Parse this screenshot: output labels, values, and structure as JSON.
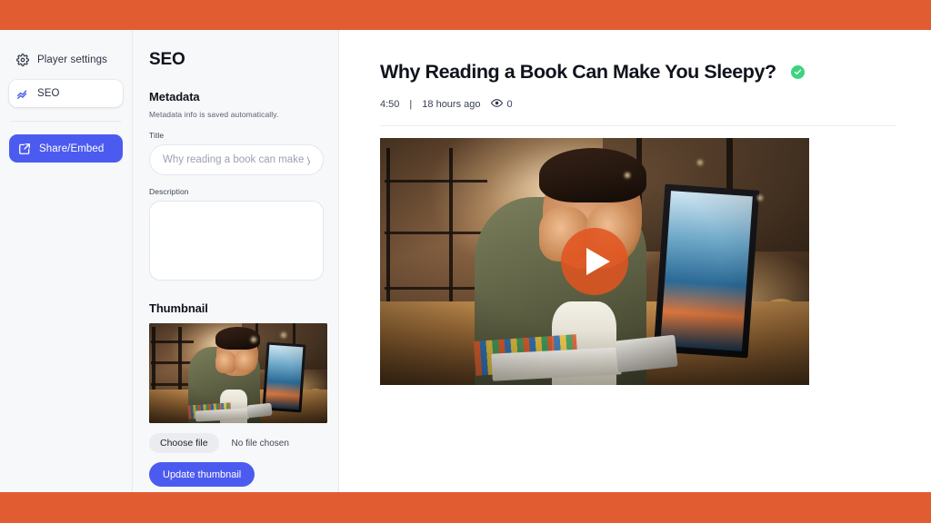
{
  "theme": {
    "frame_orange": "#E25C32",
    "accent_blue": "#4C5BEF",
    "verified_green": "#3ED47E",
    "panel_bg": "#F7F8FA"
  },
  "nav": {
    "items": [
      {
        "label": "Player settings",
        "icon": "gear-icon",
        "active": false
      },
      {
        "label": "SEO",
        "icon": "analytics-icon",
        "active": true
      }
    ],
    "cta": {
      "label": "Share/Embed",
      "icon": "share-icon"
    }
  },
  "seo": {
    "panel_title": "SEO",
    "metadata": {
      "section_title": "Metadata",
      "note": "Metadata info is saved automatically.",
      "title_label": "Title",
      "title_placeholder": "Why reading a book can make you",
      "title_value": "",
      "description_label": "Description",
      "description_placeholder": "",
      "description_value": ""
    },
    "thumbnail": {
      "section_title": "Thumbnail",
      "choose_file_label": "Choose file",
      "file_status": "No file chosen",
      "update_label": "Update thumbnail",
      "image_alt": "Tired man rubbing eyes at a desk with monitor and keyboard"
    }
  },
  "video": {
    "title": "Why Reading a Book Can Make You Sleepy?",
    "verified_badge": "check-icon",
    "duration": "4:50",
    "separator": "|",
    "published": "18 hours ago",
    "views_icon": "eye-icon",
    "views": "0",
    "play_button_label": "play-icon",
    "poster_alt": "Tired man rubbing eyes at a desk with monitor and keyboard"
  }
}
